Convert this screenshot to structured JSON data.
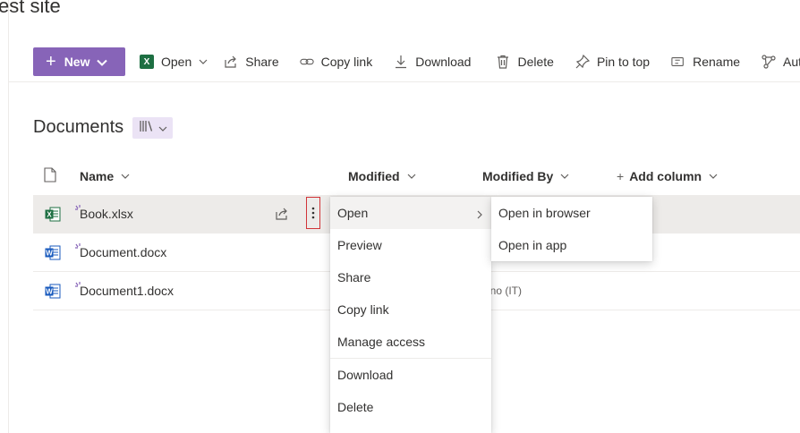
{
  "site": {
    "title": "est site"
  },
  "toolbar": {
    "new_label": "New",
    "open_label": "Open",
    "share_label": "Share",
    "copy_link_label": "Copy link",
    "download_label": "Download",
    "delete_label": "Delete",
    "pin_label": "Pin to top",
    "rename_label": "Rename",
    "automate_label": "Aut",
    "colors": {
      "new_bg": "#8764b8",
      "excel": "#1d6f42",
      "word": "#185abd"
    }
  },
  "library": {
    "title": "Documents"
  },
  "columns": {
    "name": "Name",
    "modified": "Modified",
    "modified_by": "Modified By",
    "add_column": "Add column"
  },
  "files": [
    {
      "name": "Book.xlsx",
      "type": "excel",
      "modified_by": ""
    },
    {
      "name": "Document.docx",
      "type": "word",
      "modified_by": ""
    },
    {
      "name": "Document1.docx",
      "type": "word",
      "modified_by": "runo (IT)"
    }
  ],
  "context_menu": {
    "items": [
      "Open",
      "Preview",
      "Share",
      "Copy link",
      "Manage access",
      "Download",
      "Delete"
    ]
  },
  "submenu": {
    "items": [
      "Open in browser",
      "Open in app"
    ]
  }
}
